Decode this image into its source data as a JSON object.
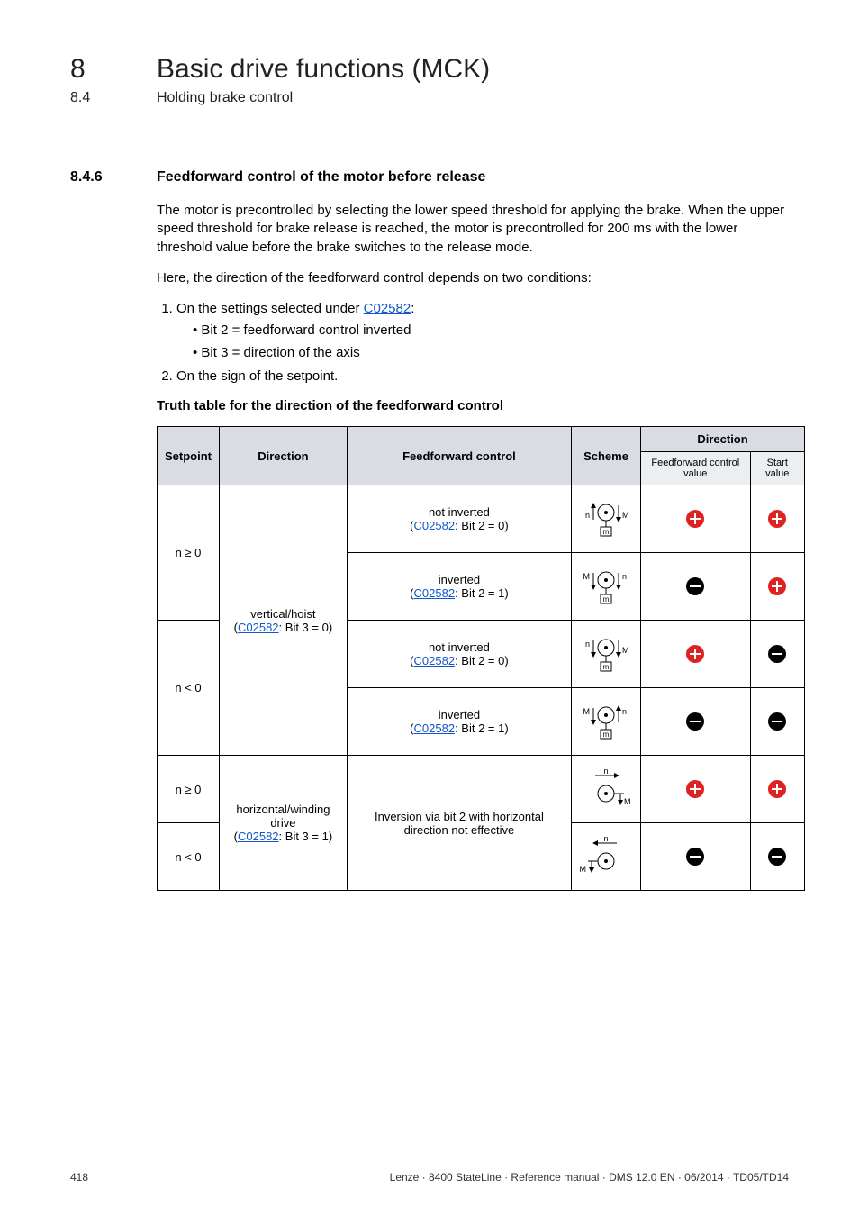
{
  "chapter": {
    "num": "8",
    "title": "Basic drive functions (MCK)"
  },
  "subchapter": {
    "num": "8.4",
    "title": "Holding brake control"
  },
  "section": {
    "num": "8.4.6",
    "title": "Feedforward control of the motor before release"
  },
  "para1": "The motor is precontrolled by selecting the lower speed threshold for applying the brake. When the upper speed threshold for brake release is reached, the motor is precontrolled for 200 ms with the lower threshold value before the brake switches to the release mode.",
  "para2": "Here, the direction of the feedforward control depends on two conditions:",
  "list1": {
    "item1_pre": "On the settings selected under ",
    "item1_link": "C02582",
    "item1_post": ":",
    "item1_sub1": "Bit 2 = feedforward control inverted",
    "item1_sub2": "Bit 3 = direction of the axis",
    "item2": "On the sign of the setpoint."
  },
  "truth_heading": "Truth table for the direction of the feedforward control",
  "table": {
    "headers": {
      "setpoint": "Setpoint",
      "direction": "Direction",
      "ffcontrol": "Feedforward control",
      "scheme": "Scheme",
      "dir2": "Direction",
      "sub_ff": "Feedforward control value",
      "sub_start": "Start value"
    },
    "link_label": "C02582",
    "rows": [
      {
        "setpoint": "n ≥ 0",
        "direction_label": "vertical/hoist",
        "direction_bit": ": Bit 3 = 0)",
        "ff_label": "not inverted",
        "ff_bit": ": Bit 2 = 0)",
        "ff_sign": "plus",
        "start_sign": "plus"
      },
      {
        "ff_label": "inverted",
        "ff_bit": ": Bit 2 = 1)",
        "ff_sign": "minus",
        "start_sign": "plus"
      },
      {
        "setpoint": "n < 0",
        "ff_label": "not inverted",
        "ff_bit": ": Bit 2 = 0)",
        "ff_sign": "plus",
        "start_sign": "minus"
      },
      {
        "ff_label": "inverted",
        "ff_bit": ": Bit 2 = 1)",
        "ff_sign": "minus",
        "start_sign": "minus"
      },
      {
        "setpoint": "n ≥ 0",
        "direction_label": "horizontal/winding drive",
        "direction_bit": ": Bit 3 = 1)",
        "ff_label": "Inversion via bit 2 with horizontal direction not effective",
        "ff_sign": "plus",
        "start_sign": "plus"
      },
      {
        "setpoint": "n < 0",
        "ff_sign": "minus",
        "start_sign": "minus"
      }
    ]
  },
  "footer": {
    "page": "418",
    "right": "Lenze · 8400 StateLine · Reference manual · DMS 12.0 EN · 06/2014 · TD05/TD14"
  }
}
